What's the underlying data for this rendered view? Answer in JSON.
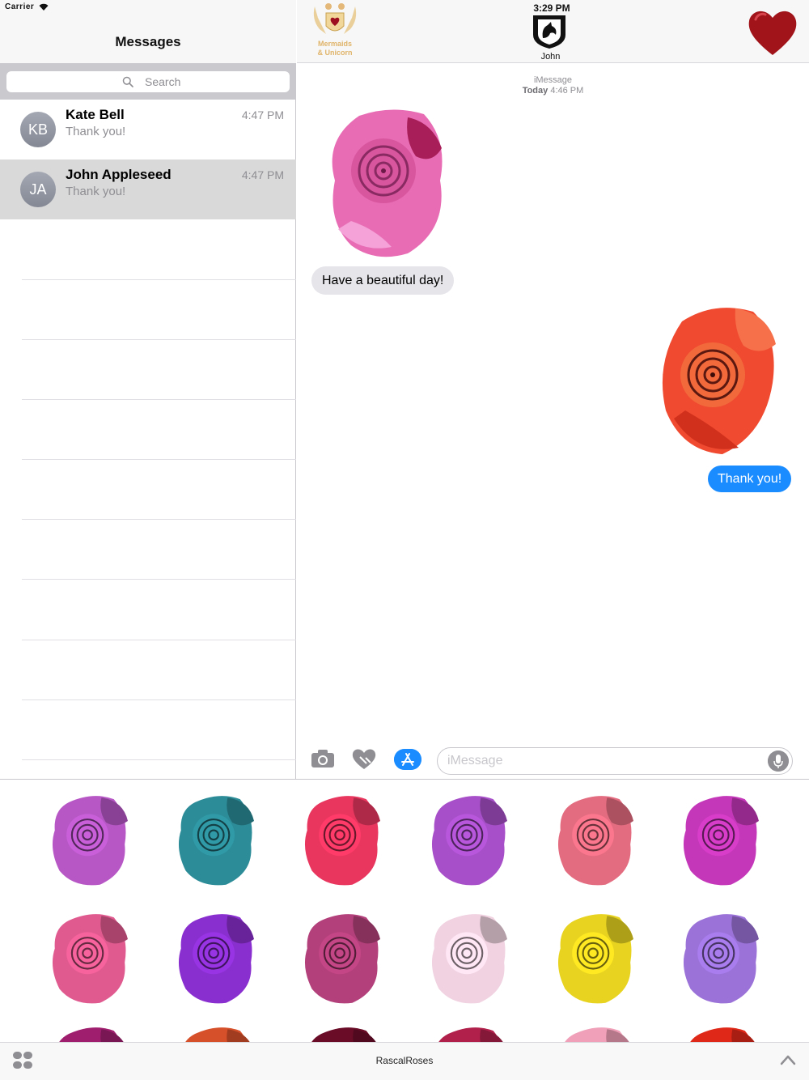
{
  "status_bar": {
    "carrier": "Carrier",
    "time": "3:29 PM"
  },
  "left": {
    "title": "Messages",
    "search_placeholder": "Search",
    "conversations": [
      {
        "initials": "KB",
        "name": "Kate Bell",
        "preview": "Thank you!",
        "time": "4:47 PM",
        "selected": false
      },
      {
        "initials": "JA",
        "name": "John Appleseed",
        "preview": "Thank you!",
        "time": "4:47 PM",
        "selected": true
      }
    ]
  },
  "header": {
    "logo_text_line1": "Mermaids",
    "logo_text_line2": "& Unicorn",
    "contact_name": "John"
  },
  "chat": {
    "service": "iMessage",
    "timestamp_day": "Today",
    "timestamp_time": "4:46 PM",
    "incoming_text": "Have a beautiful day!",
    "outgoing_text": "Thank you!",
    "incoming_sticker_color": "#e060a8",
    "outgoing_sticker_color": "#f04a30"
  },
  "input": {
    "placeholder": "iMessage"
  },
  "colors": {
    "accent": "#1a8cff",
    "heart": "#a0141a"
  },
  "drawer": {
    "app_name": "RascalRoses",
    "stickers": [
      "#b757c6",
      "#2c8c98",
      "#e8365f",
      "#a74fc8",
      "#e46c80",
      "#c437b8",
      "#e05a8f",
      "#8a2fcf",
      "#b3407a",
      "#f0d2e0",
      "#e8d420",
      "#9a72d8"
    ],
    "partial_stickers": [
      "#a01e6e",
      "#d6502a",
      "#6a0c28",
      "#b0204a",
      "#f0a0b8",
      "#e02818"
    ]
  }
}
